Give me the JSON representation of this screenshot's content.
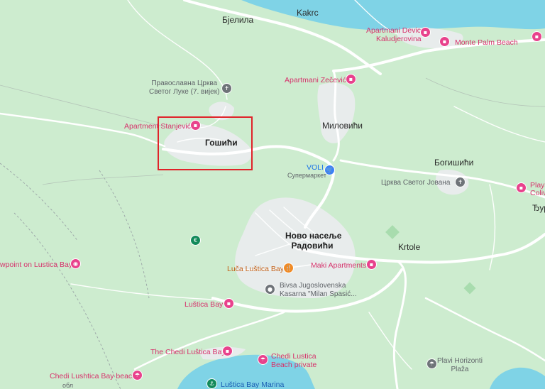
{
  "colors": {
    "land": "#cdeccf",
    "water": "#7fd3e6",
    "urban": "#e8ecec",
    "road": "#ffffff",
    "selection": "#e0232a",
    "poi_pink": "#e8428c",
    "poi_orange": "#f08a24",
    "poi_gray": "#6f7479",
    "poi_blue": "#3b82f6",
    "poi_green": "#128a5a"
  },
  "places": {
    "bjelila": "Бјелила",
    "kakrc": "Kakrc",
    "gosici": "Гошићи",
    "milovici": "Миловићи",
    "bogisici": "Богишићи",
    "novo_naselje": "Ново насеље",
    "radovici": "Радовићи",
    "krtole": "Krtole",
    "djur": "Ђур"
  },
  "pois": {
    "apartmani_devic_1": "Apartmani Devic",
    "apartmani_devic_2": "Kaludjerovina",
    "monte_palm": "Monte Palm Beach",
    "zecevic": "Apartmani Zečević",
    "church_luke_1": "Православна Црква",
    "church_luke_2": "Светог Луке (7. вијек)",
    "stanjevic": "Apartment Stanjević",
    "voli": "VOLI",
    "voli_sub": "Супермаркет",
    "church_jovan": "Црква Светог Јована",
    "playa_1": "Playa",
    "playa_2": "Coliv",
    "viewpoint": "wpoint on Lustica Bay",
    "luca": "Luča Luštica Bay",
    "maki": "Maki Apartments",
    "kasarna_1": "Bivsa Jugoslovenska",
    "kasarna_2": "Kasarna \"Milan Spasić...",
    "lustica_bay": "Luštica Bay",
    "chedi_1": "The Chedi Luštica Bay",
    "chedi_private_1": "Chedi Lustica",
    "chedi_private_2": "Beach private",
    "chedi_beach": "Chedi Lushtica Bay beach",
    "marina": "Luštica Bay Marina",
    "plavi_1": "Plavi Horizonti",
    "plavi_2": "Plaža",
    "bottom_cut": "обл"
  }
}
